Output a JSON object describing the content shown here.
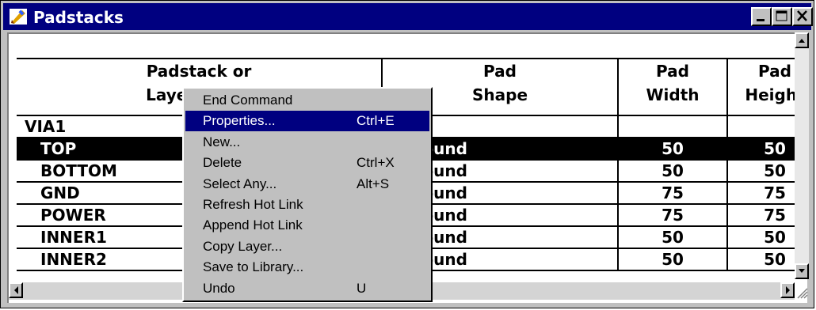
{
  "window": {
    "title": "Padstacks"
  },
  "table": {
    "headers": [
      {
        "line1": "Padstack or",
        "line2": "Layer Name"
      },
      {
        "line1": "Pad",
        "line2": "Shape"
      },
      {
        "line1": "Pad",
        "line2": "Width"
      },
      {
        "line1": "Pad",
        "line2": "Height"
      }
    ],
    "rows": [
      {
        "name": "VIA1",
        "shape": "",
        "width": "",
        "height": ""
      },
      {
        "name": "TOP",
        "shape": "Round",
        "width": "50",
        "height": "50"
      },
      {
        "name": "BOTTOM",
        "shape": "Round",
        "width": "50",
        "height": "50"
      },
      {
        "name": "GND",
        "shape": "Round",
        "width": "75",
        "height": "75"
      },
      {
        "name": "POWER",
        "shape": "Round",
        "width": "75",
        "height": "75"
      },
      {
        "name": "INNER1",
        "shape": "Round",
        "width": "50",
        "height": "50"
      },
      {
        "name": "INNER2",
        "shape": "Round",
        "width": "50",
        "height": "50"
      }
    ]
  },
  "context_menu": {
    "items": [
      {
        "label": "End Command",
        "shortcut": ""
      },
      {
        "label": "Properties...",
        "shortcut": "Ctrl+E"
      },
      {
        "label": "New...",
        "shortcut": ""
      },
      {
        "label": "Delete",
        "shortcut": "Ctrl+X"
      },
      {
        "label": "Select Any...",
        "shortcut": "Alt+S"
      },
      {
        "label": "Refresh Hot Link",
        "shortcut": ""
      },
      {
        "label": "Append Hot Link",
        "shortcut": ""
      },
      {
        "label": "Copy Layer...",
        "shortcut": ""
      },
      {
        "label": "Save to Library...",
        "shortcut": ""
      },
      {
        "label": "Undo",
        "shortcut": "U"
      }
    ]
  },
  "colors": {
    "titlebar": "#000080",
    "selection": "#000000",
    "menu_highlight": "#000080"
  },
  "icons": {
    "app": "padstack-app-icon",
    "minimize": "minimize-icon",
    "maximize": "maximize-icon",
    "close": "close-icon"
  }
}
